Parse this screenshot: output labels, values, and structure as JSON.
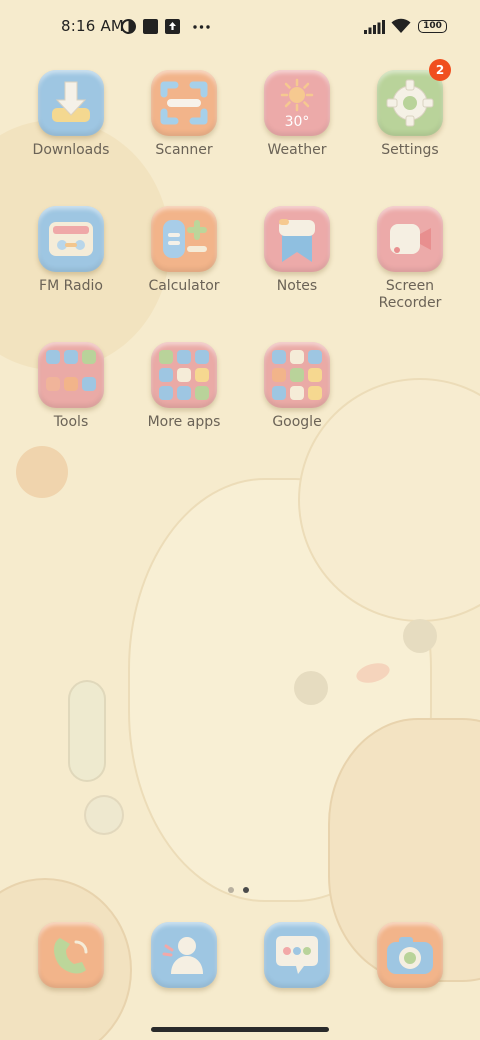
{
  "status_bar": {
    "time": "8:16 AM",
    "battery": "100",
    "icons": [
      "data-saver-icon",
      "square-notification-icon",
      "upload-icon",
      "more-dots-icon",
      "signal-icon",
      "wifi-icon",
      "battery-icon"
    ]
  },
  "apps": [
    {
      "label": "Downloads",
      "icon": "download-icon"
    },
    {
      "label": "Scanner",
      "icon": "scanner-icon"
    },
    {
      "label": "Weather",
      "icon": "sun-icon",
      "temp": "30°"
    },
    {
      "label": "Settings",
      "icon": "gear-icon",
      "badge": "2"
    },
    {
      "label": "FM Radio",
      "icon": "radio-icon"
    },
    {
      "label": "Calculator",
      "icon": "calculator-icon"
    },
    {
      "label": "Notes",
      "icon": "notes-icon"
    },
    {
      "label": "Screen Recorder",
      "label_line1": "Screen",
      "label_line2": "Recorder",
      "icon": "video-camera-icon"
    }
  ],
  "folders": [
    {
      "label": "Tools"
    },
    {
      "label": "More apps"
    },
    {
      "label": "Google"
    }
  ],
  "page_indicator": {
    "count": 2,
    "active": 2
  },
  "dock": [
    {
      "icon": "phone-icon"
    },
    {
      "icon": "contacts-icon"
    },
    {
      "icon": "messages-icon"
    },
    {
      "icon": "camera-icon"
    }
  ],
  "colors": {
    "background": "#f6ebcd",
    "tile_blue": "#9ec6e2",
    "tile_orange": "#f2b48a",
    "tile_pink": "#eeaaa6",
    "tile_green": "#b9d39a",
    "badge": "#f04f1f"
  }
}
